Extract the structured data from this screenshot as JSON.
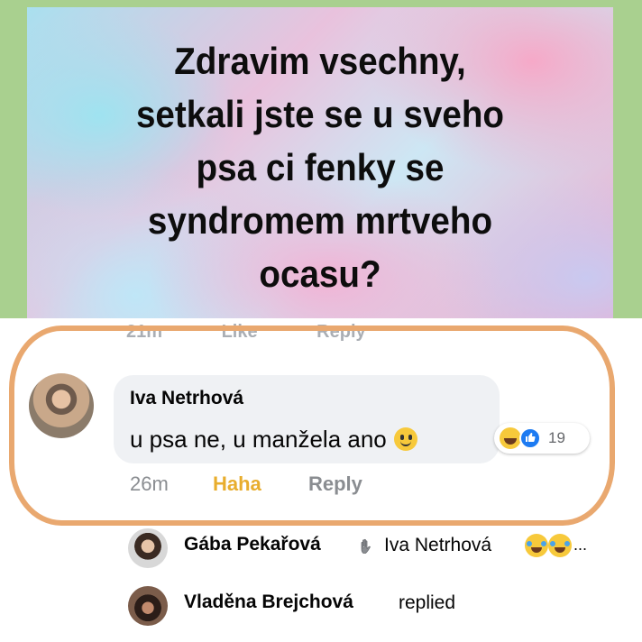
{
  "post": {
    "text": "Zdravim vsechny,\nsetkali jste se u sveho\npsa ci fenky se\nsyndromem mrtveho\nocasu?"
  },
  "ghost_row": "21m Like Reply",
  "comment": {
    "author": "Iva Netrhová",
    "text": "u psa ne, u manžela ano",
    "reaction_count": "19",
    "time": "26m",
    "reaction_label": "Haha",
    "reply_label": "Reply",
    "icons": [
      "smile-emoji",
      "haha-reaction-icon",
      "like-reaction-icon"
    ]
  },
  "replies": [
    {
      "author": "Gába Pekařová",
      "tail": "Iva Netrhová",
      "ellipsis": "...",
      "icons": [
        "hand-icon",
        "crying-laughing-emoji"
      ]
    },
    {
      "author": "Vladěna Brejchová",
      "tail": "replied"
    }
  ],
  "colors": {
    "frame": "#a9d08f",
    "highlight": "#e9a86f",
    "haha": "#e8ad2d",
    "meta_grey": "#8a8d91",
    "like_blue": "#1d7bf2"
  }
}
